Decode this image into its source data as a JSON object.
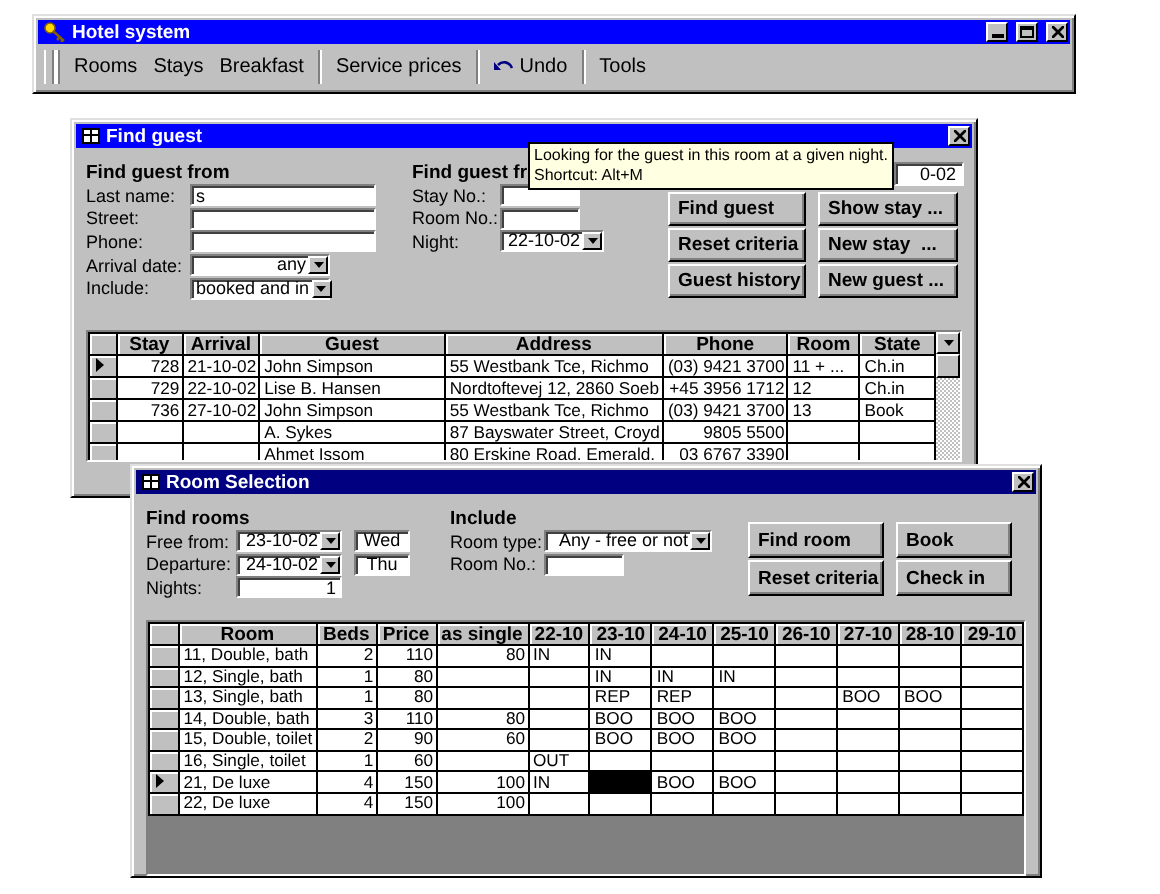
{
  "main_window": {
    "title": "Hotel system",
    "toolbar_groups": [
      {
        "items": [
          {
            "label": "Rooms",
            "kind": "text"
          },
          {
            "label": "Stays",
            "kind": "text"
          },
          {
            "label": "Breakfast",
            "kind": "text"
          }
        ]
      },
      {
        "items": [
          {
            "label": "Service prices",
            "kind": "text"
          }
        ]
      },
      {
        "items": [
          {
            "label": "Undo",
            "kind": "undo"
          }
        ]
      },
      {
        "items": [
          {
            "label": "Tools",
            "kind": "text"
          }
        ]
      }
    ]
  },
  "find_guest": {
    "title": "Find guest",
    "criteria_1": {
      "heading": "Find guest from",
      "fields": [
        {
          "label": "Last name:",
          "kind": "text",
          "value": "s"
        },
        {
          "label": "Street:",
          "kind": "text"
        },
        {
          "label": "Phone:",
          "kind": "text"
        },
        {
          "label": "Arrival date:",
          "kind": "combo",
          "value": "any"
        },
        {
          "label": "Include:",
          "kind": "combo",
          "value": "booked and in"
        }
      ]
    },
    "criteria_2": {
      "heading": "Find guest fr",
      "fields": [
        {
          "label": "Stay No.:",
          "kind": "text"
        },
        {
          "label": "Room No.:",
          "kind": "text"
        },
        {
          "label": "Night:",
          "kind": "combo",
          "value": "22-10-02"
        }
      ]
    },
    "partial_field": {
      "value": "0-02"
    },
    "buttons": [
      "Find guest",
      "Show stay ...",
      "Reset criteria",
      "New stay  ...",
      "Guest history",
      "New guest ..."
    ],
    "tooltip": {
      "lines": [
        "Looking for the guest in this room at a given night.",
        "Shortcut: Alt+M"
      ]
    },
    "table": {
      "columns": [
        "Stay",
        "Arrival",
        "Guest",
        "Address",
        "Phone",
        "Room",
        "State"
      ],
      "rows": [
        {
          "current": true,
          "cells": [
            "728",
            "21-10-02",
            "John Simpson",
            "55 Westbank Tce, Richmo",
            "(03) 9421 3700",
            "11 + ...",
            "Ch.in"
          ]
        },
        {
          "current": false,
          "cells": [
            "729",
            "22-10-02",
            "Lise B. Hansen",
            "Nordtoftevej 12, 2860 Soeb",
            "+45 3956 1712",
            "12",
            "Ch.in"
          ]
        },
        {
          "current": false,
          "cells": [
            "736",
            "27-10-02",
            "John Simpson",
            "55 Westbank Tce, Richmo",
            "(03) 9421 3700",
            "13",
            "Book"
          ]
        },
        {
          "current": false,
          "cells": [
            null,
            null,
            "A. Sykes",
            "87 Bayswater Street, Croyd",
            "9805 5500",
            null,
            null
          ]
        },
        {
          "current": false,
          "cells": [
            null,
            null,
            "Ahmet Issom",
            "80 Erskine Road, Emerald,",
            "03 6767 3390",
            null,
            null
          ]
        }
      ]
    }
  },
  "room_selection": {
    "title": "Room Selection",
    "find_rooms": {
      "heading": "Find rooms",
      "fields": [
        {
          "label": "Free from:",
          "kind": "combo",
          "value": "23-10-02",
          "day": "Wed"
        },
        {
          "label": "Departure:",
          "kind": "combo",
          "value": "24-10-02",
          "day": "Thu"
        },
        {
          "label": "Nights:",
          "kind": "text",
          "value": "1"
        }
      ]
    },
    "include": {
      "heading": "Include",
      "fields": [
        {
          "label": "Room type:",
          "kind": "combo",
          "value": "Any - free or not"
        },
        {
          "label": "Room No.:",
          "kind": "text"
        }
      ]
    },
    "buttons": [
      "Find room",
      "Book",
      "Reset criteria",
      "Check in"
    ],
    "table": {
      "columns": [
        "Room",
        "Beds",
        "Price",
        "as single",
        "22-10",
        "23-10",
        "24-10",
        "25-10",
        "26-10",
        "27-10",
        "28-10",
        "29-10"
      ],
      "rows": [
        {
          "current": false,
          "cells": [
            "11, Double, bath",
            "2",
            "110",
            "80"
          ],
          "nights": [
            {
              "text": "IN",
              "selected": false
            },
            {
              "text": "IN",
              "selected": false
            },
            {
              "selected": false
            },
            {
              "selected": false
            },
            {
              "selected": false
            },
            {
              "selected": false
            },
            {
              "selected": false
            },
            {
              "selected": false
            }
          ]
        },
        {
          "current": false,
          "cells": [
            "12, Single, bath",
            "1",
            "80",
            null
          ],
          "nights": [
            {
              "selected": false
            },
            {
              "text": "IN",
              "selected": false
            },
            {
              "text": "IN",
              "selected": false
            },
            {
              "text": "IN",
              "selected": false
            },
            {
              "selected": false
            },
            {
              "selected": false
            },
            {
              "selected": false
            },
            {
              "selected": false
            }
          ]
        },
        {
          "current": false,
          "cells": [
            "13, Single, bath",
            "1",
            "80",
            null
          ],
          "nights": [
            {
              "selected": false
            },
            {
              "text": "REP",
              "selected": false
            },
            {
              "text": "REP",
              "selected": false
            },
            {
              "selected": false
            },
            {
              "selected": false
            },
            {
              "text": "BOO",
              "selected": false
            },
            {
              "text": "BOO",
              "selected": false
            },
            {
              "selected": false
            }
          ]
        },
        {
          "current": false,
          "cells": [
            "14, Double, bath",
            "3",
            "110",
            "80"
          ],
          "nights": [
            {
              "selected": false
            },
            {
              "text": "BOO",
              "selected": false
            },
            {
              "text": "BOO",
              "selected": false
            },
            {
              "text": "BOO",
              "selected": false
            },
            {
              "selected": false
            },
            {
              "selected": false
            },
            {
              "selected": false
            },
            {
              "selected": false
            }
          ]
        },
        {
          "current": false,
          "cells": [
            "15, Double, toilet",
            "2",
            "90",
            "60"
          ],
          "nights": [
            {
              "selected": false
            },
            {
              "text": "BOO",
              "selected": false
            },
            {
              "text": "BOO",
              "selected": false
            },
            {
              "text": "BOO",
              "selected": false
            },
            {
              "selected": false
            },
            {
              "selected": false
            },
            {
              "selected": false
            },
            {
              "selected": false
            }
          ]
        },
        {
          "current": false,
          "cells": [
            "16, Single, toilet",
            "1",
            "60",
            null
          ],
          "nights": [
            {
              "text": "OUT",
              "selected": false
            },
            {
              "selected": false
            },
            {
              "selected": false
            },
            {
              "selected": false
            },
            {
              "selected": false
            },
            {
              "selected": false
            },
            {
              "selected": false
            },
            {
              "selected": false
            }
          ]
        },
        {
          "current": true,
          "cells": [
            "21, De luxe",
            "4",
            "150",
            "100"
          ],
          "nights": [
            {
              "text": "IN",
              "selected": false
            },
            {
              "selected": true
            },
            {
              "text": "BOO",
              "selected": false
            },
            {
              "text": "BOO",
              "selected": false
            },
            {
              "selected": false
            },
            {
              "selected": false
            },
            {
              "selected": false
            },
            {
              "selected": false
            }
          ]
        },
        {
          "current": false,
          "cells": [
            "22, De luxe",
            "4",
            "150",
            "100"
          ],
          "nights": [
            {
              "selected": false
            },
            {
              "selected": false
            },
            {
              "selected": false
            },
            {
              "selected": false
            },
            {
              "selected": false
            },
            {
              "selected": false
            },
            {
              "selected": false
            },
            {
              "selected": false
            }
          ]
        }
      ]
    }
  }
}
